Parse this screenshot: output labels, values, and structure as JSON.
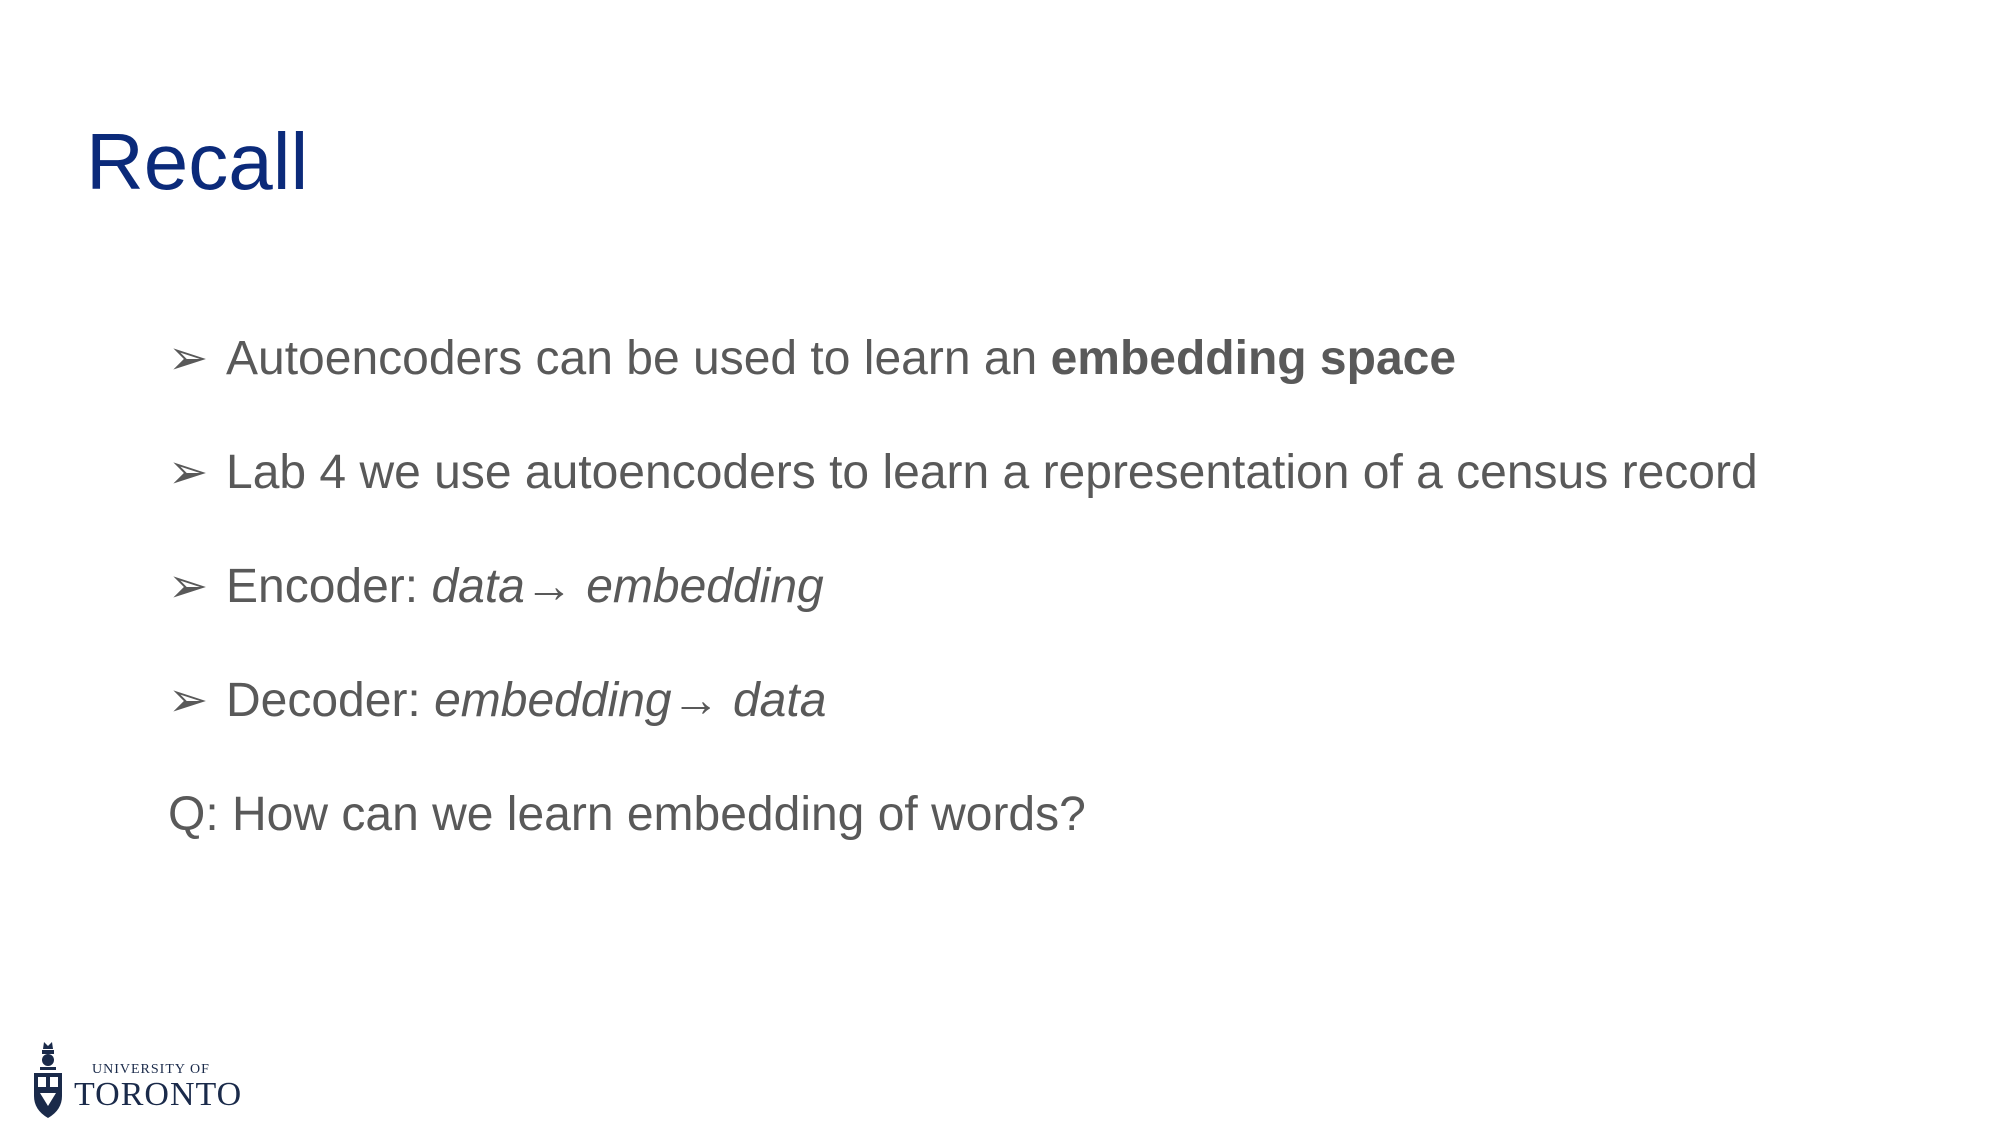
{
  "slide": {
    "title": "Recall",
    "bullet_marker": "➢",
    "bullets": [
      {
        "text": "Autoencoders can be used to learn an ",
        "strong": "embedding space"
      },
      {
        "text": "Lab 4 we use autoencoders to learn a representation of a census record"
      },
      {
        "text": "Encoder: ",
        "em": "data→ embedding"
      },
      {
        "text": "Decoder: ",
        "em": "embedding→ data"
      }
    ],
    "question": "Q: How can we learn embedding of words?"
  },
  "logo": {
    "line1": "UNIVERSITY OF",
    "line2": "TORONTO"
  },
  "colors": {
    "title": "#0b2a7a",
    "body_text": "#595959",
    "logo": "#1a2a4a"
  }
}
